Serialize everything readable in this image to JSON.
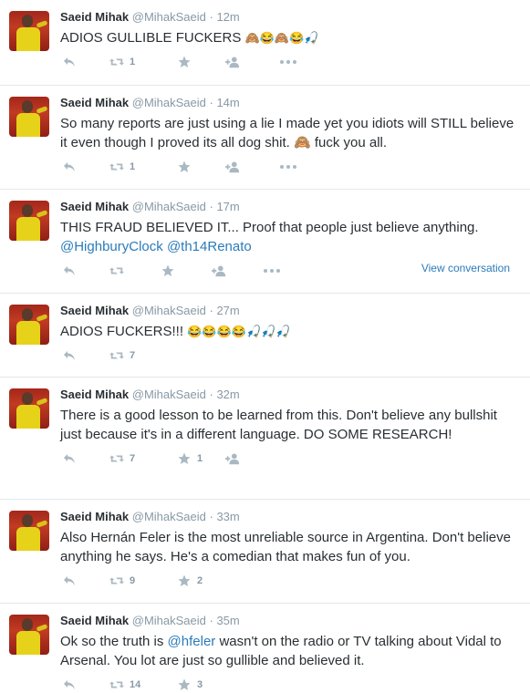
{
  "colors": {
    "link": "#2b7bb9",
    "muted": "#8899a6",
    "icon": "#aab8c2",
    "name": "#292f33"
  },
  "tweets": [
    {
      "name": "Saeid Mihak",
      "handle": "@MihakSaeid",
      "time": "· 12m",
      "text": "ADIOS GULLIBLE FUCKERS ",
      "emoji": "🙈😂🙈😂🎣",
      "retweets": "1",
      "favorites": ""
    },
    {
      "name": "Saeid Mihak",
      "handle": "@MihakSaeid",
      "time": "· 14m",
      "text": "So many reports are just using a lie I made yet you idiots will STILL believe it even though I proved its all dog shit. 🙈 fuck you all.",
      "retweets": "1",
      "favorites": ""
    },
    {
      "name": "Saeid Mihak",
      "handle": "@MihakSaeid",
      "time": "· 17m",
      "text": "THIS FRAUD BELIEVED IT... Proof that people just believe anything. ",
      "mentions": [
        "@HighburyClock",
        "@th14Renato"
      ],
      "retweets": "",
      "favorites": "",
      "view_conversation": "View conversation"
    },
    {
      "name": "Saeid Mihak",
      "handle": "@MihakSaeid",
      "time": "· 27m",
      "text": "ADIOS FUCKERS!!! ",
      "emoji": "😂😂😂😂🎣🎣🎣",
      "retweets": "7",
      "favorites": ""
    },
    {
      "name": "Saeid Mihak",
      "handle": "@MihakSaeid",
      "time": "· 32m",
      "text": "There is a good lesson to be learned from this. Don't believe any bullshit just because it's in a different language. DO SOME RESEARCH!",
      "retweets": "7",
      "favorites": "1"
    },
    {
      "name": "Saeid Mihak",
      "handle": "@MihakSaeid",
      "time": "· 33m",
      "text": "Also Hernán Feler is the most unreliable source in Argentina. Don't believe anything he says. He's a comedian that makes fun of you.",
      "retweets": "9",
      "favorites": "2"
    },
    {
      "name": "Saeid Mihak",
      "handle": "@MihakSaeid",
      "time": "· 35m",
      "text_before": "Ok so the truth is ",
      "mention": "@hfeler",
      "text_after": " wasn't on the radio or TV talking about Vidal to Arsenal. You lot are just so gullible and believed it.",
      "retweets": "14",
      "favorites": "3"
    }
  ]
}
